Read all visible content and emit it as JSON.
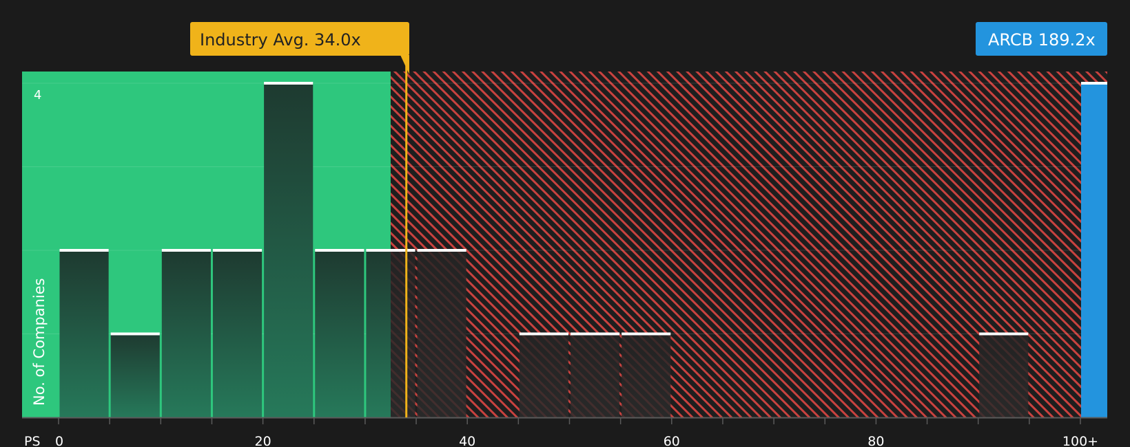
{
  "chart_data": {
    "type": "bar",
    "xlabel": "PS",
    "ylabel": "No. of Companies",
    "x_tick_labels": [
      "0",
      "20",
      "40",
      "60",
      "80",
      "100+"
    ],
    "y_tick_labels": [
      "4"
    ],
    "xlim": [
      0,
      100
    ],
    "ylim": [
      0,
      4
    ],
    "bin_width": 5,
    "bins": [
      {
        "start": 0,
        "end": 5,
        "count": 2
      },
      {
        "start": 5,
        "end": 10,
        "count": 1
      },
      {
        "start": 10,
        "end": 15,
        "count": 2
      },
      {
        "start": 15,
        "end": 20,
        "count": 2
      },
      {
        "start": 20,
        "end": 25,
        "count": 4
      },
      {
        "start": 25,
        "end": 30,
        "count": 2
      },
      {
        "start": 30,
        "end": 35,
        "count": 2
      },
      {
        "start": 35,
        "end": 40,
        "count": 2
      },
      {
        "start": 45,
        "end": 50,
        "count": 1
      },
      {
        "start": 50,
        "end": 55,
        "count": 1
      },
      {
        "start": 55,
        "end": 60,
        "count": 1
      },
      {
        "start": 90,
        "end": 95,
        "count": 1
      },
      {
        "start": 100,
        "end": 103,
        "count": 4,
        "highlight": true
      }
    ],
    "fair_zone_end": 32.5,
    "industry_avg": {
      "label": "Industry Avg. 34.0x",
      "value": 34.0
    },
    "company": {
      "label": "ARCB 189.2x",
      "value": 189.2
    },
    "grid": true,
    "colors": {
      "background": "#1b1b1b",
      "fair_zone": "#2ec77d",
      "over_zone_hatch": "#c9423f",
      "bar_dark": "#1f3a31",
      "company_bar": "#2394de",
      "industry_callout": "#f0b31a",
      "company_callout": "#2394de"
    }
  }
}
